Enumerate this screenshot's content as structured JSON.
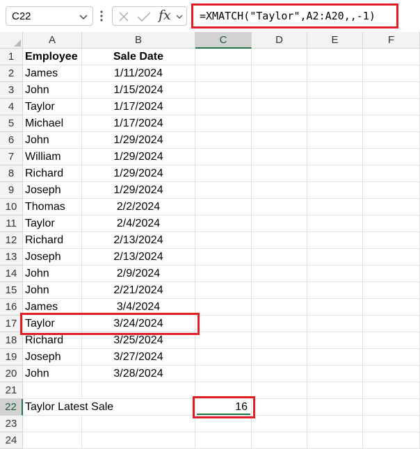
{
  "formula_bar": {
    "name_box": "C22",
    "fx_label": "fx",
    "formula": "=XMATCH(\"Taylor\",A2:A20,,-1)"
  },
  "columns": [
    "A",
    "B",
    "C",
    "D",
    "E",
    "F"
  ],
  "rows": [
    {
      "num": "1",
      "a": "Employee",
      "b": "Sale Date"
    },
    {
      "num": "2",
      "a": "James",
      "b": "1/11/2024"
    },
    {
      "num": "3",
      "a": "John",
      "b": "1/15/2024"
    },
    {
      "num": "4",
      "a": "Taylor",
      "b": "1/17/2024"
    },
    {
      "num": "5",
      "a": "Michael",
      "b": "1/17/2024"
    },
    {
      "num": "6",
      "a": "John",
      "b": "1/29/2024"
    },
    {
      "num": "7",
      "a": "William",
      "b": "1/29/2024"
    },
    {
      "num": "8",
      "a": "Richard",
      "b": "1/29/2024"
    },
    {
      "num": "9",
      "a": "Joseph",
      "b": "1/29/2024"
    },
    {
      "num": "10",
      "a": "Thomas",
      "b": "2/2/2024"
    },
    {
      "num": "11",
      "a": "Taylor",
      "b": "2/4/2024"
    },
    {
      "num": "12",
      "a": "Richard",
      "b": "2/13/2024"
    },
    {
      "num": "13",
      "a": "Joseph",
      "b": "2/13/2024"
    },
    {
      "num": "14",
      "a": "John",
      "b": "2/9/2024"
    },
    {
      "num": "15",
      "a": "John",
      "b": "2/21/2024"
    },
    {
      "num": "16",
      "a": "James",
      "b": "3/4/2024"
    },
    {
      "num": "17",
      "a": "Taylor",
      "b": "3/24/2024"
    },
    {
      "num": "18",
      "a": "Richard",
      "b": "3/25/2024"
    },
    {
      "num": "19",
      "a": "Joseph",
      "b": "3/27/2024"
    },
    {
      "num": "20",
      "a": "John",
      "b": "3/28/2024"
    },
    {
      "num": "21",
      "a": "",
      "b": ""
    },
    {
      "num": "22",
      "a": "Taylor Latest Sale",
      "b": "",
      "c": "16"
    },
    {
      "num": "23",
      "a": "",
      "b": ""
    },
    {
      "num": "24",
      "a": "",
      "b": ""
    }
  ],
  "active_cell": "C22",
  "highlight_color": "#e21d25",
  "accent_color": "#217346"
}
